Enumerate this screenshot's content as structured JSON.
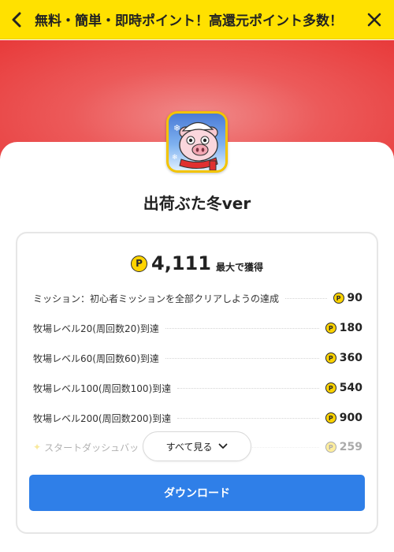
{
  "header": {
    "title": "無料・簡単・即時ポイント！高還元ポイント多数！",
    "back_icon": "chevron-left-icon",
    "close_icon": "close-icon",
    "background": "#ffe100"
  },
  "app": {
    "name": "出荷ぶた冬ver",
    "icon": "pig-app-icon"
  },
  "points": {
    "coin_symbol": "P",
    "total": "4,111",
    "total_label": "最大で獲得"
  },
  "missions": [
    {
      "label": "ミッション：初心者ミッションを全部クリアしようの達成",
      "points": "90"
    },
    {
      "label": "牧場レベル20(周回数20)到達",
      "points": "180"
    },
    {
      "label": "牧場レベル60(周回数60)到達",
      "points": "360"
    },
    {
      "label": "牧場レベル100(周回数100)到達",
      "points": "540"
    },
    {
      "label": "牧場レベル200(周回数200)到達",
      "points": "900"
    },
    {
      "label": "スタートダッシュバッ",
      "points": "259"
    }
  ],
  "see_all_label": "すべて見る",
  "download_label": "ダウンロード",
  "colors": {
    "accent_blue": "#2f7fe8",
    "hero_red": "#e83a3a",
    "coin_yellow": "#ffd400"
  }
}
